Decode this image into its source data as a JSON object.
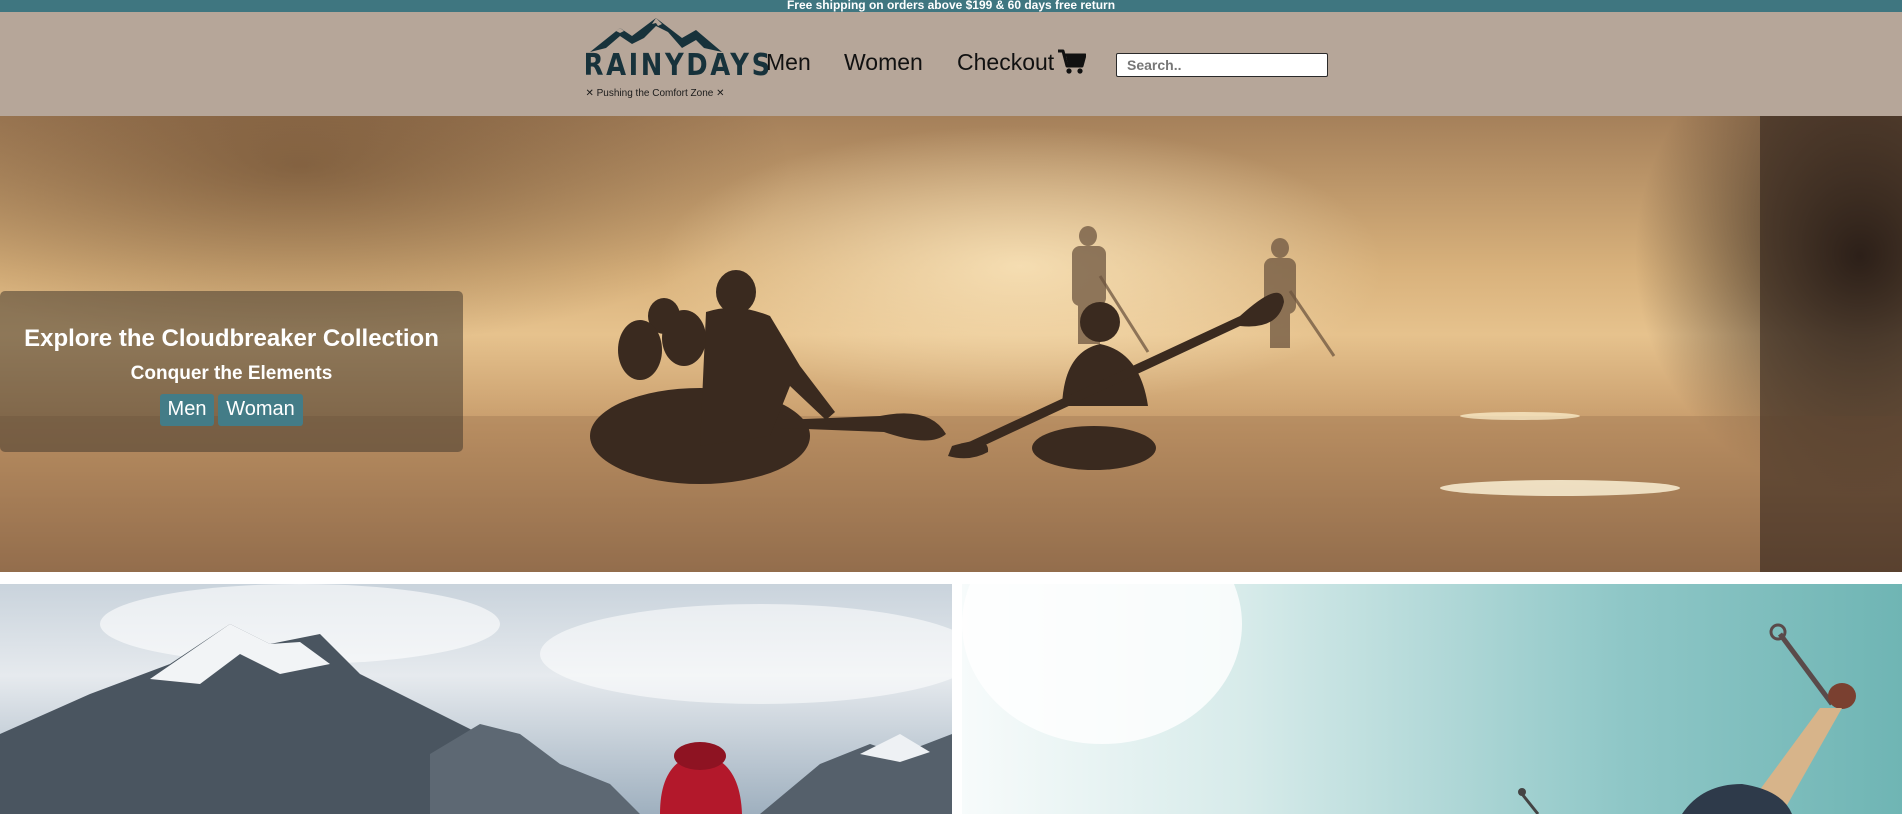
{
  "announcement": "Free shipping on orders above $199 & 60 days free return",
  "brand": {
    "name": "RAINYDAYS",
    "tagline": "✕ Pushing the Comfort Zone ✕",
    "logo_icon": "mountain-icon"
  },
  "nav": {
    "items": [
      {
        "label": "Men"
      },
      {
        "label": "Women"
      },
      {
        "label": "Checkout"
      }
    ],
    "cart_icon": "cart-icon"
  },
  "search": {
    "placeholder": "Search..",
    "value": ""
  },
  "hero": {
    "title": "Explore the Cloudbreaker Collection",
    "subtitle": "Conquer the Elements",
    "buttons": [
      {
        "label": "Men"
      },
      {
        "label": "Woman"
      }
    ]
  },
  "colors": {
    "topbar": "#3f7680",
    "header": "#b6a699",
    "accent_button": "#437c87",
    "logo": "#17323b"
  }
}
